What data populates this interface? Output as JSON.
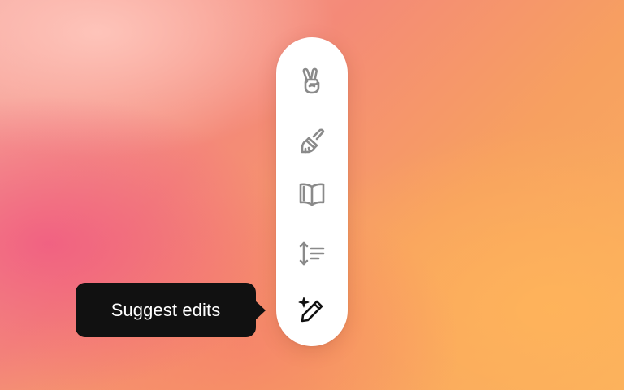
{
  "toolbar": {
    "items": [
      {
        "icon": "peace-hand-icon"
      },
      {
        "icon": "paintbrush-icon"
      },
      {
        "icon": "book-open-icon"
      },
      {
        "icon": "text-length-icon"
      },
      {
        "icon": "sparkle-pencil-icon"
      }
    ]
  },
  "tooltip": {
    "label": "Suggest edits"
  },
  "colors": {
    "tooltip_bg": "#111111",
    "toolbar_bg": "#ffffff",
    "icon_gray": "#8a8a8a",
    "icon_active": "#111111"
  }
}
